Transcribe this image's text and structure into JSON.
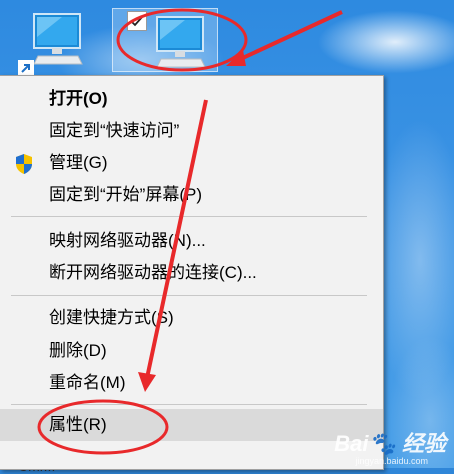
{
  "desktop": {
    "icons": [
      {
        "name": "computer-shortcut"
      },
      {
        "name": "this-pc-selected"
      }
    ],
    "bottom_text": "Cmr... "
  },
  "context_menu": {
    "items": [
      {
        "label": "打开(O)",
        "bold": true
      },
      {
        "label": "固定到“快速访问”"
      },
      {
        "label": "管理(G)",
        "icon": "shield-icon"
      },
      {
        "label": "固定到“开始”屏幕(P)"
      },
      {
        "label": "映射网络驱动器(N)..."
      },
      {
        "label": "断开网络驱动器的连接(C)..."
      },
      {
        "label": "创建快捷方式(S)"
      },
      {
        "label": "删除(D)"
      },
      {
        "label": "重命名(M)"
      },
      {
        "label": "属性(R)",
        "highlighted": true
      }
    ]
  },
  "watermark": {
    "text": "Bai🐾 经验",
    "sub": "jingyan.baidu.com"
  },
  "colors": {
    "annotation_red": "#e8292b",
    "menu_bg": "#f2f2f2",
    "hover_bg": "#dadada"
  }
}
